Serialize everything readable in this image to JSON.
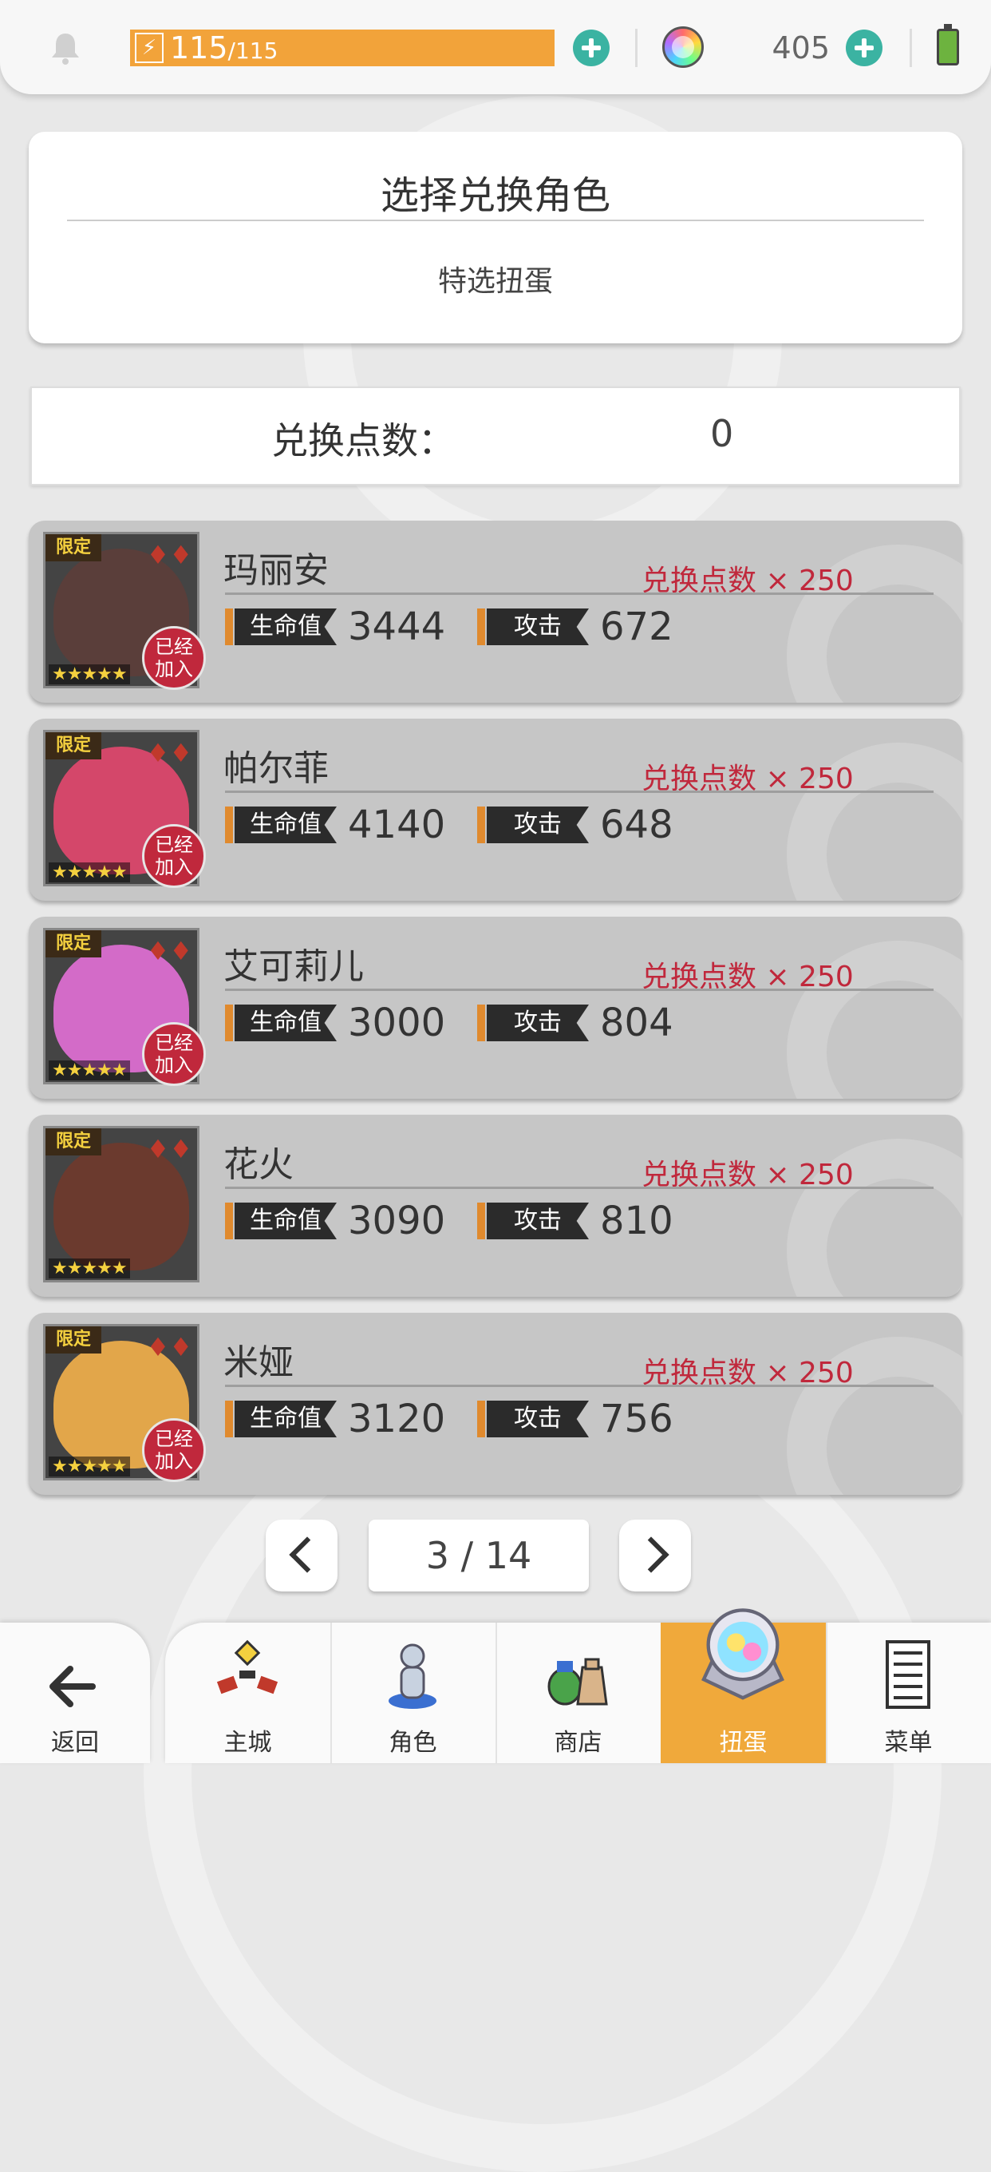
{
  "topbar": {
    "stamina_current": "115",
    "stamina_max": "/115",
    "gems": "405",
    "icons": [
      "bell-icon",
      "lightning-icon",
      "plus-icon",
      "rainbow-gem-icon",
      "battery-icon"
    ]
  },
  "select": {
    "title": "选择兑换角色",
    "subtitle": "特选扭蛋"
  },
  "points": {
    "label": "兑换点数：",
    "value": "0"
  },
  "labels": {
    "hp": "生命值",
    "atk": "攻击",
    "limited": "限定",
    "joined_line1": "已经",
    "joined_line2": "加入",
    "stars": "★★★★★",
    "suit": "♦♦"
  },
  "characters": [
    {
      "name": "玛丽安",
      "cost": "兑换点数 × 250",
      "hp": "3444",
      "atk": "672",
      "joined": true,
      "portrait_color": "#5a3e3a"
    },
    {
      "name": "帕尔菲",
      "cost": "兑换点数 × 250",
      "hp": "4140",
      "atk": "648",
      "joined": true,
      "portrait_color": "#d4476a"
    },
    {
      "name": "艾可莉儿",
      "cost": "兑换点数 × 250",
      "hp": "3000",
      "atk": "804",
      "joined": true,
      "portrait_color": "#d36bc8"
    },
    {
      "name": "花火",
      "cost": "兑换点数 × 250",
      "hp": "3090",
      "atk": "810",
      "joined": false,
      "portrait_color": "#6b3a2e"
    },
    {
      "name": "米娅",
      "cost": "兑换点数 × 250",
      "hp": "3120",
      "atk": "756",
      "joined": true,
      "portrait_color": "#e2a64a"
    }
  ],
  "pager": {
    "indicator": "3 / 14"
  },
  "nav": {
    "back": "返回",
    "items": [
      "主城",
      "角色",
      "商店",
      "扭蛋",
      "菜单"
    ],
    "active": "扭蛋"
  }
}
